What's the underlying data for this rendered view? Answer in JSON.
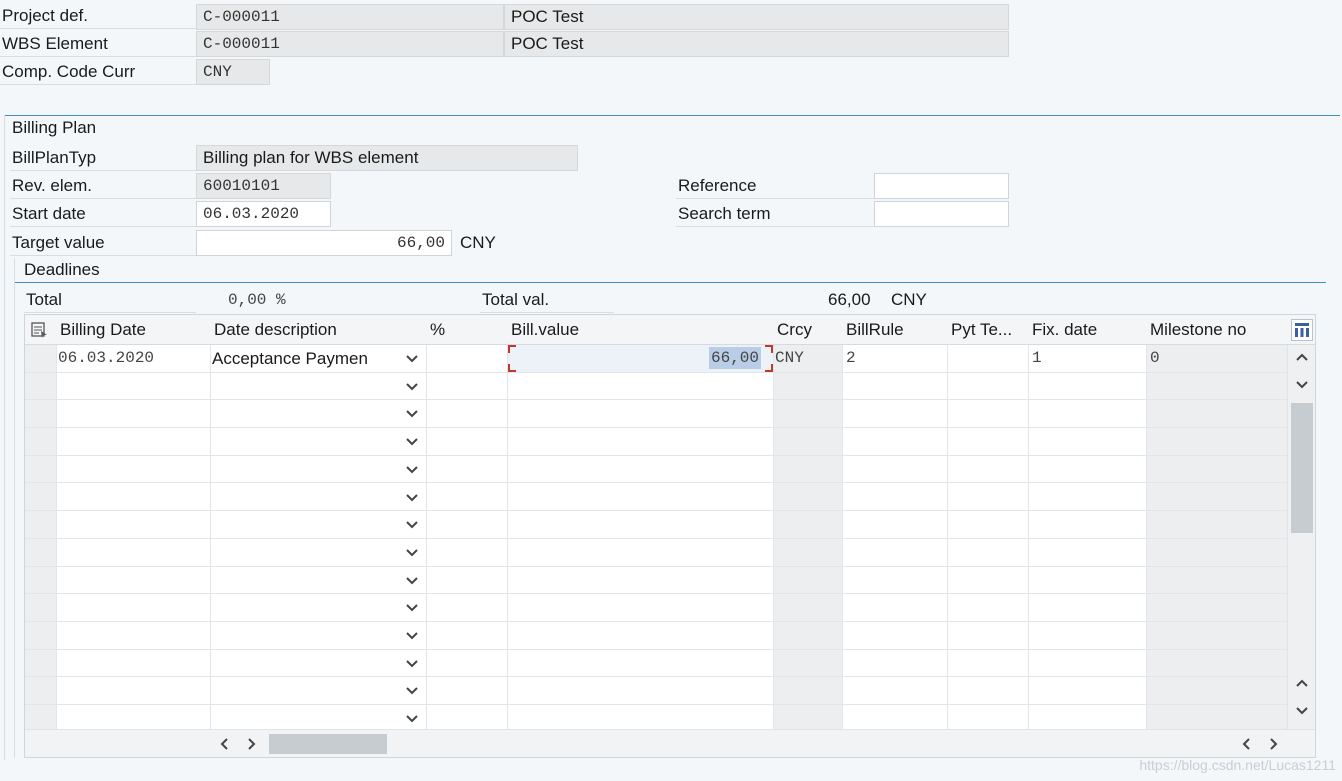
{
  "header_fields": {
    "project_def": {
      "label": "Project def.",
      "value": "C-000011",
      "desc": "POC Test"
    },
    "wbs_element": {
      "label": "WBS Element",
      "value": "C-000011",
      "desc": "POC Test"
    },
    "comp_code_curr": {
      "label": "Comp. Code Curr",
      "value": "CNY"
    }
  },
  "billing_plan": {
    "title": "Billing Plan",
    "bill_plan_typ": {
      "label": "BillPlanTyp",
      "value": "Billing plan for WBS element"
    },
    "rev_elem": {
      "label": "Rev. elem.",
      "value": "60010101"
    },
    "start_date": {
      "label": "Start date",
      "value": "06.03.2020"
    },
    "target_value": {
      "label": "Target value",
      "value": "66,00",
      "currency": "CNY"
    },
    "reference": {
      "label": "Reference",
      "value": ""
    },
    "search_term": {
      "label": "Search term",
      "value": ""
    }
  },
  "deadlines": {
    "title": "Deadlines",
    "total_label": "Total",
    "total_pct": "0,00 %",
    "total_val_label": "Total val.",
    "total_val": "66,00",
    "total_val_currency": "CNY",
    "columns": [
      "Billing Date",
      "Date description",
      "%",
      "Bill.value",
      "Crcy",
      "BillRule",
      "Pyt Te...",
      "Fix. date",
      "Milestone no"
    ],
    "rows": [
      {
        "billing_date": "06.03.2020",
        "date_description": "Acceptance Paymen",
        "pct": "",
        "bill_value": "66,00",
        "crcy": "CNY",
        "bill_rule": "2",
        "pyt_terms": "",
        "fix_date": "1",
        "milestone_no": "0"
      }
    ],
    "empty_row_count": 13
  },
  "watermark": "https://blog.csdn.net/Lucas1211",
  "colors": {
    "accent": "#3d8fc4",
    "selection": "#c8d7ea",
    "focus_marker": "#c0392b"
  }
}
